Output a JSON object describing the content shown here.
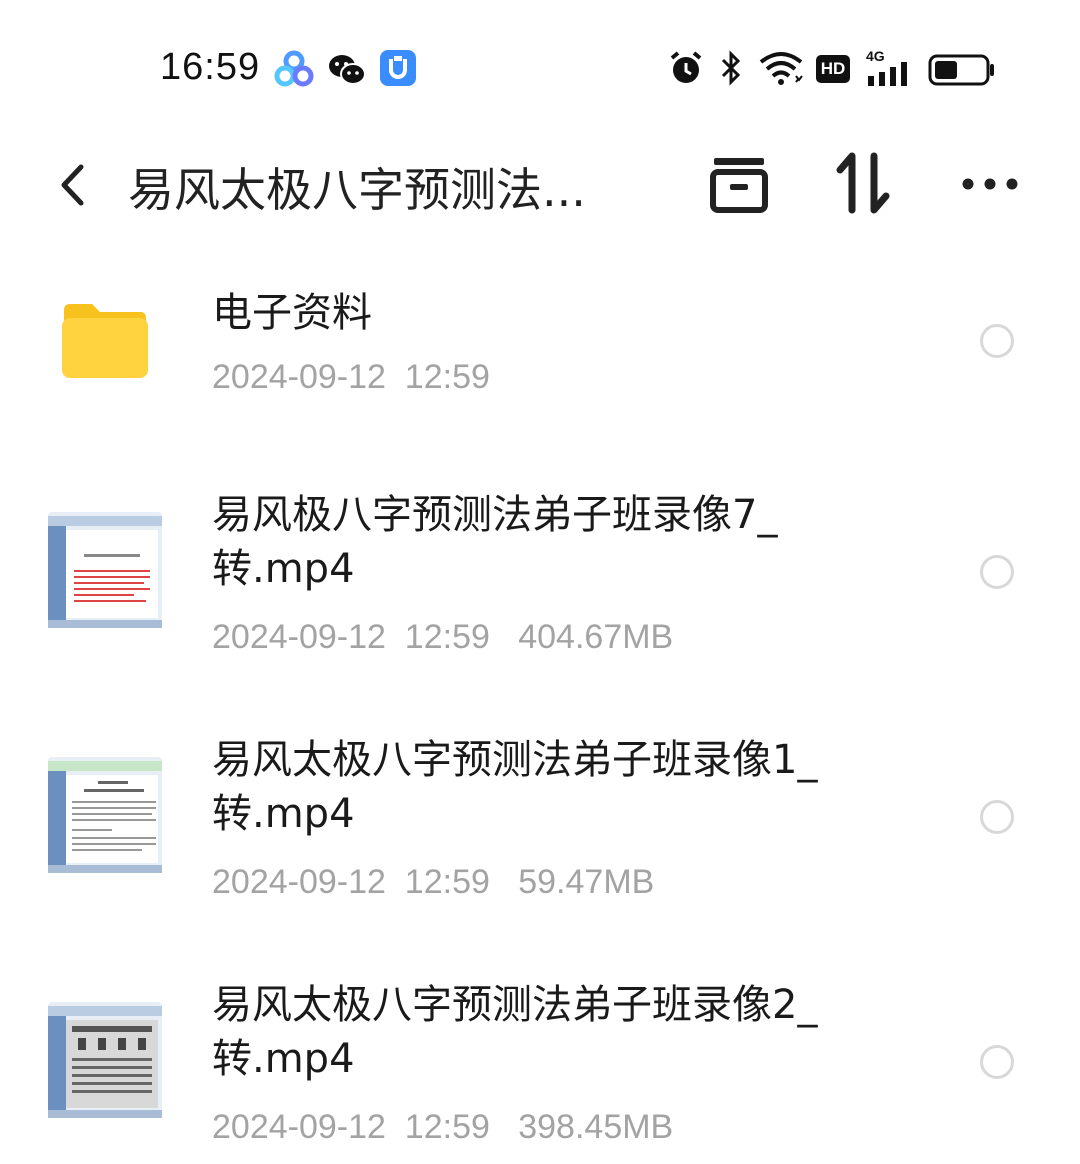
{
  "status_bar": {
    "time": "16:59",
    "app_icons": [
      "baidu-netdisk-icon",
      "wechat-icon",
      "app-u-icon"
    ],
    "system_icons": [
      "alarm-icon",
      "bluetooth-icon",
      "wifi-icon",
      "hd-icon",
      "signal-4g-icon",
      "battery-icon"
    ],
    "hd_label": "HD",
    "network_label": "4G",
    "battery_level": 0.45
  },
  "header": {
    "title": "易风太极八字预测法...",
    "actions": [
      "archive-icon",
      "sort-icon",
      "more-icon"
    ]
  },
  "files": [
    {
      "type": "folder",
      "name": "电子资料",
      "meta": "2024-09-12  12:59",
      "thumbnail": "folder-icon"
    },
    {
      "type": "video",
      "name": "易风极八字预测法弟子班录像7_转.mp4",
      "meta": "2024-09-12  12:59   404.67MB",
      "thumbnail": "video-thumbnail"
    },
    {
      "type": "video",
      "name": "易风太极八字预测法弟子班录像1_转.mp4",
      "meta": "2024-09-12  12:59   59.47MB",
      "thumbnail": "video-thumbnail"
    },
    {
      "type": "video",
      "name": "易风太极八字预测法弟子班录像2_转.mp4",
      "meta": "2024-09-12  12:59   398.45MB",
      "thumbnail": "video-thumbnail"
    }
  ],
  "colors": {
    "folder_yellow": "#FFD23F",
    "meta_gray": "#A3A3A3",
    "radio_border": "#D8D8D8",
    "app_blue": "#3A8DFF"
  }
}
